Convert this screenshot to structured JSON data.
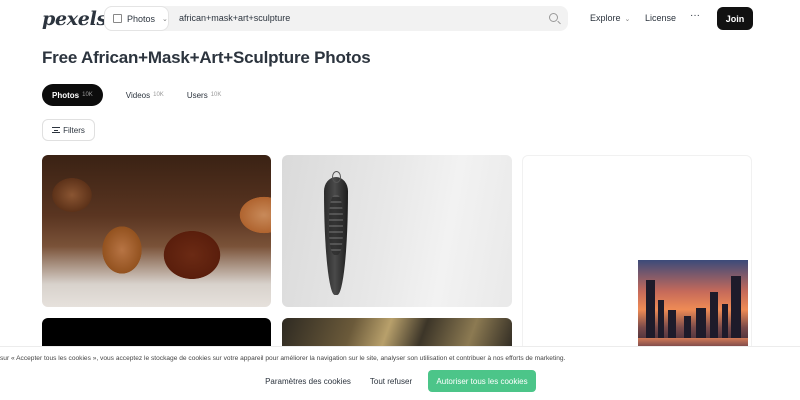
{
  "header": {
    "logo": "pexels",
    "search": {
      "type_label": "Photos",
      "query": "african+mask+art+sculpture"
    },
    "nav": {
      "explore": "Explore",
      "license": "License",
      "more": "···",
      "join": "Join"
    }
  },
  "page": {
    "title": "Free African+Mask+Art+Sculpture Photos",
    "tabs": [
      {
        "label": "Photos",
        "count": "10K",
        "active": true
      },
      {
        "label": "Videos",
        "count": "10K",
        "active": false
      },
      {
        "label": "Users",
        "count": "10K",
        "active": false
      }
    ],
    "filters_label": "Filters"
  },
  "cookie_banner": {
    "text": "sur « Accepter tous les cookies », vous acceptez le stockage de cookies sur votre appareil pour améliorer la navigation sur le site, analyser son utilisation et contribuer à nos efforts de marketing.",
    "settings_label": "Paramètres des cookies",
    "refuse_label": "Tout refuser",
    "accept_label": "Autoriser tous les cookies",
    "accept_color": "#4cc589"
  }
}
